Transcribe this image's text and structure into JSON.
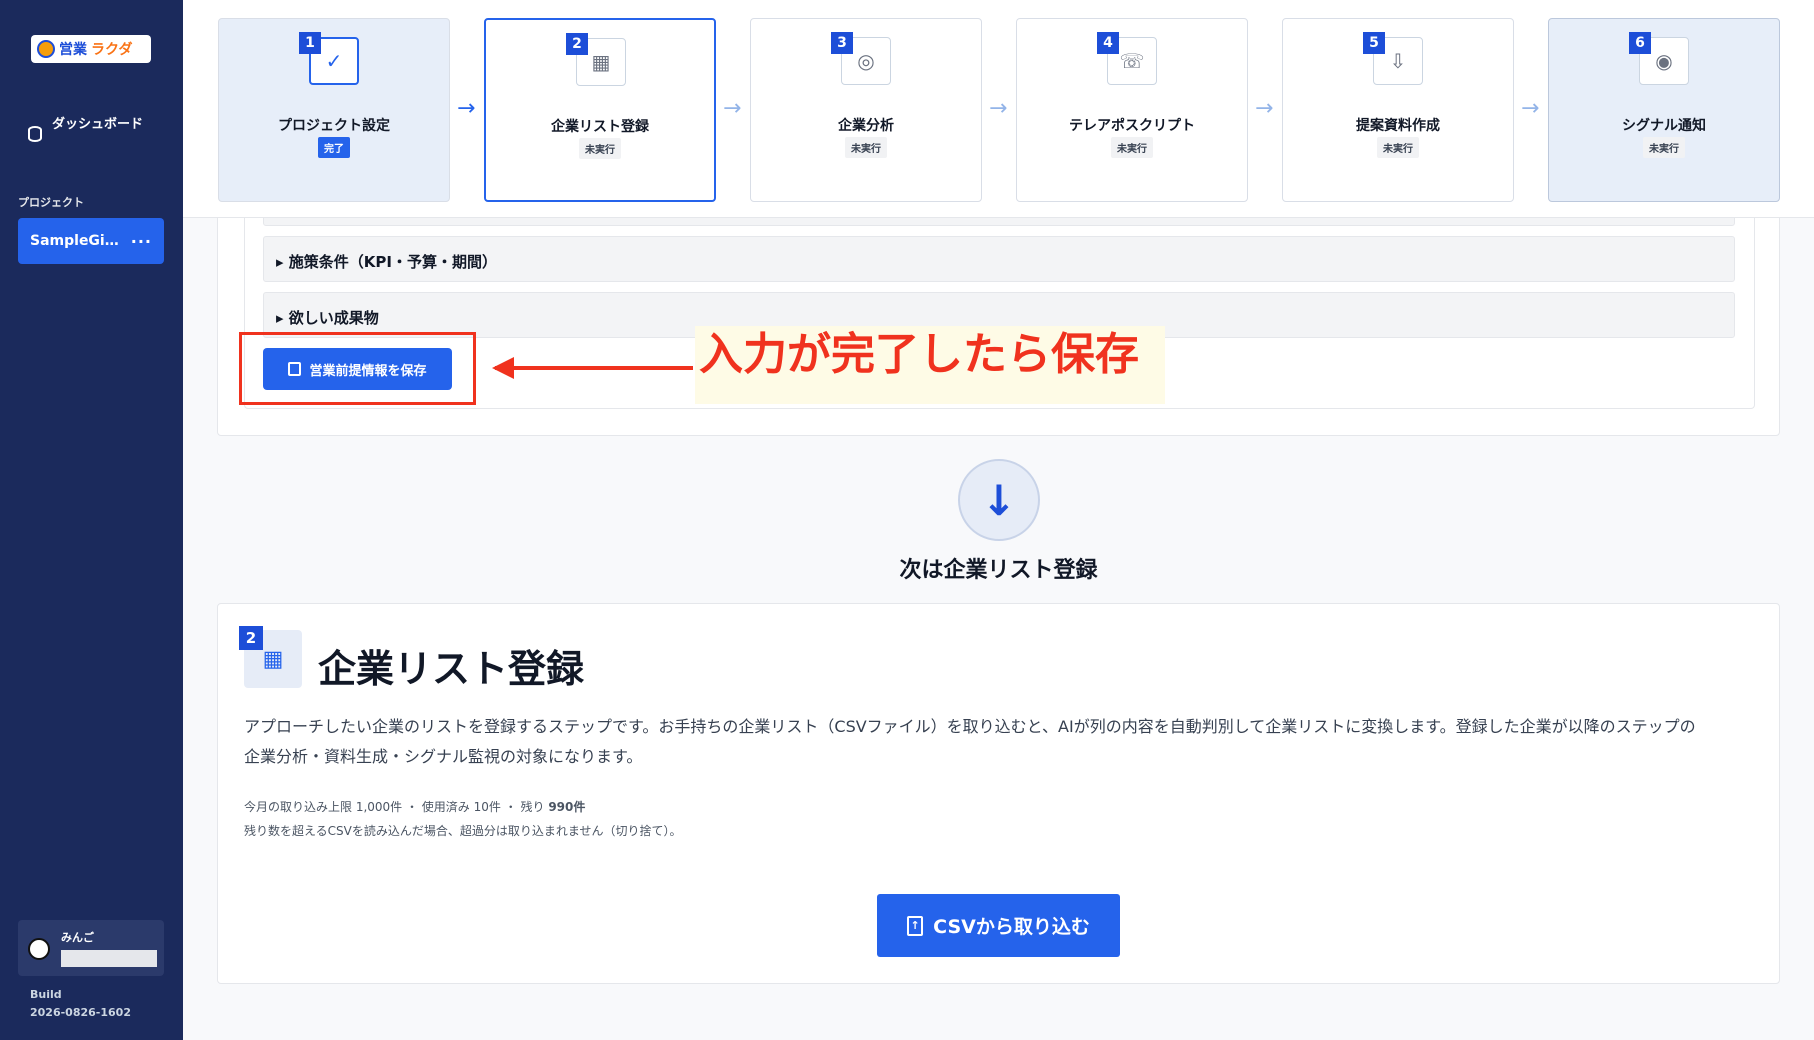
{
  "sidebar": {
    "logo_part1": "営業",
    "logo_part2": "ラクダ",
    "nav_dashboard": "ダッシュボード",
    "projects_heading": "プロジェクト",
    "project_name": "SampleGi…",
    "project_menu": "···",
    "user_name": "みんご",
    "build_label": "Build",
    "build_number": "2026-0826-1602"
  },
  "steps": [
    {
      "num": "1",
      "name": "プロジェクト設定",
      "status": "完了",
      "icon": "check-icon"
    },
    {
      "num": "2",
      "name": "企業リスト登録",
      "status": "未実行",
      "icon": "building-icon"
    },
    {
      "num": "3",
      "name": "企業分析",
      "status": "未実行",
      "icon": "analysis-icon"
    },
    {
      "num": "4",
      "name": "テレアポスクリプト",
      "status": "未実行",
      "icon": "phone-icon"
    },
    {
      "num": "5",
      "name": "提案資料作成",
      "status": "未実行",
      "icon": "document-icon"
    },
    {
      "num": "6",
      "name": "シグナル通知",
      "status": "未実行",
      "icon": "radar-icon"
    }
  ],
  "form": {
    "accordion_1": "▸ 施策条件（KPI・予算・期間）",
    "accordion_2": "▸ 欲しい成果物",
    "save_button": "営業前提情報を保存"
  },
  "annotation": "入力が完了したら保存",
  "next": {
    "label": "次は企業リスト登録"
  },
  "section": {
    "num": "2",
    "title": "企業リスト登録",
    "desc_line1": "アプローチしたい企業のリストを登録するステップです。お手持ちの企業リスト（CSVファイル）を取り込むと、AIが列の内容を自動判別して企業リストに変換します。登録した企業が以降のステップの",
    "desc_line2": "企業分析・資料生成・シグナル監視の対象になります。",
    "limit_prefix": "今月の取り込み上限 1,000件 ・ 使用済み 10件 ・ 残り ",
    "limit_remaining": "990件",
    "limit_note": "残り数を超えるCSVを読み込んだ場合、超過分は取り込まれません（切り捨て）。",
    "csv_button": "CSVから取り込む"
  },
  "colors": {
    "sidebar_bg": "#1b2a5c",
    "primary": "#2563eb",
    "annotation_red": "#f0321e"
  }
}
